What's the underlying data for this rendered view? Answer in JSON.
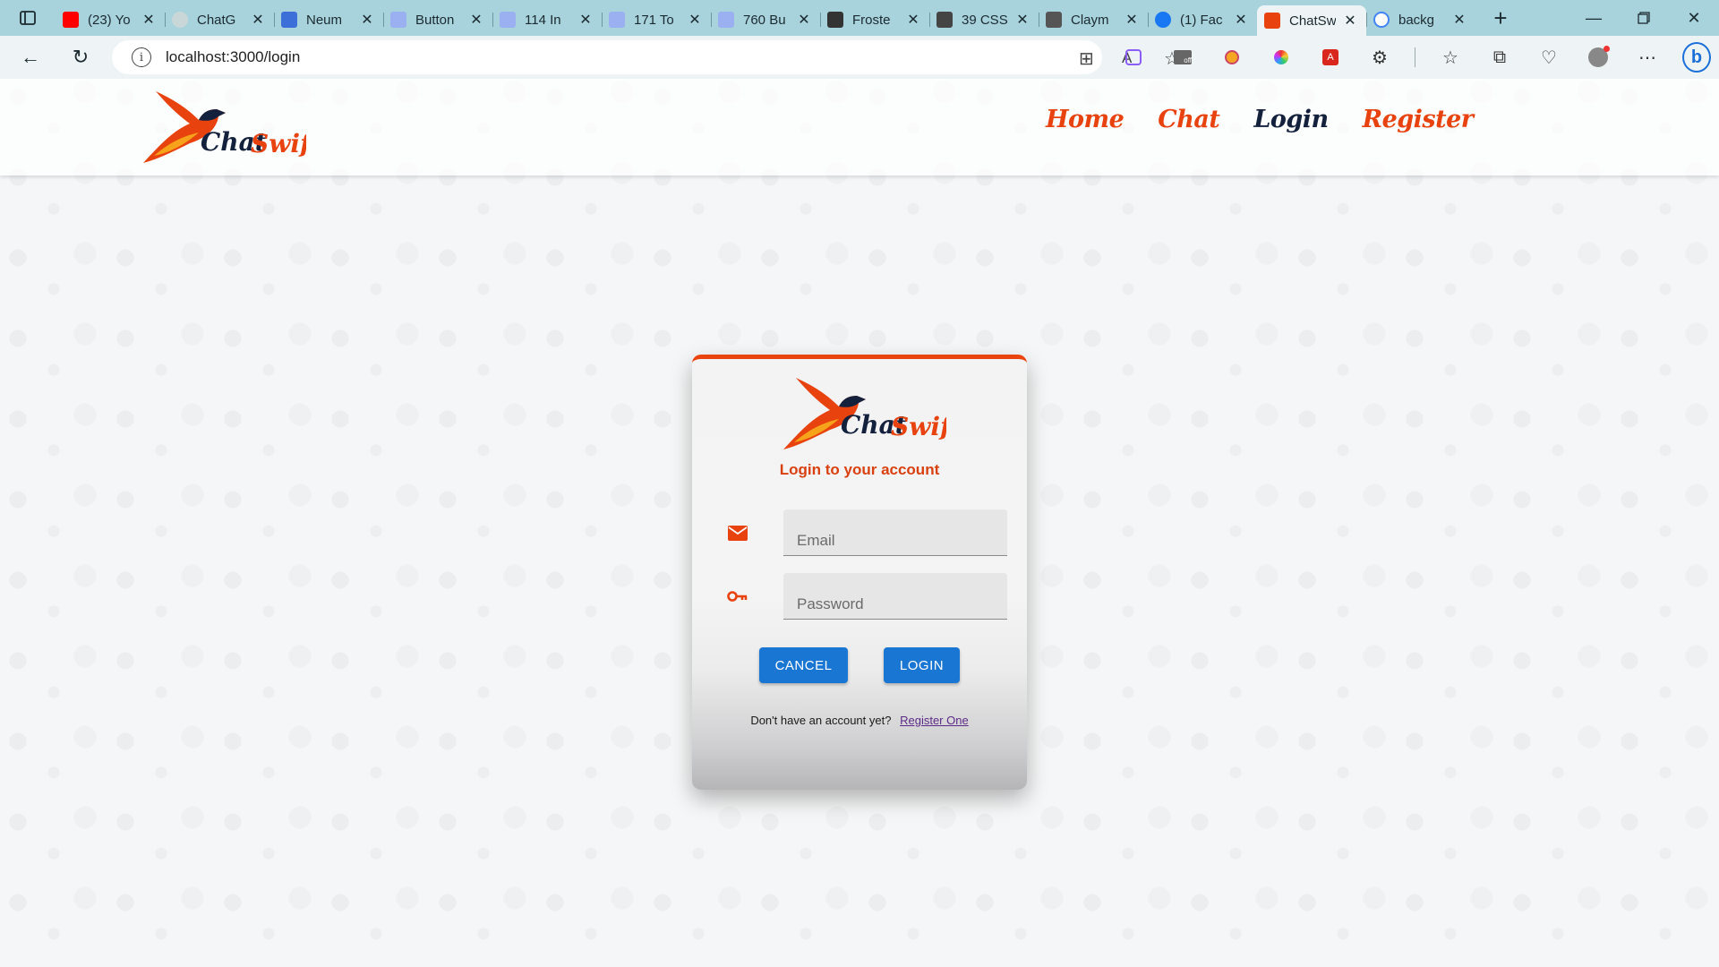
{
  "browser": {
    "tabs": [
      {
        "title": "(23) Yo",
        "favicon": "youtube-icon",
        "color": "#ff0000"
      },
      {
        "title": "ChatG",
        "favicon": "chatgpt-icon",
        "color": "#c9d7d9"
      },
      {
        "title": "Neum",
        "favicon": "neumorphism-icon",
        "color": "#3d6fd8"
      },
      {
        "title": "Button",
        "favicon": "uiverse-icon",
        "color": "#9ab0f0"
      },
      {
        "title": "114 In",
        "favicon": "uiverse-icon",
        "color": "#9ab0f0"
      },
      {
        "title": "171 To",
        "favicon": "uiverse-icon",
        "color": "#9ab0f0"
      },
      {
        "title": "760 Bu",
        "favicon": "uiverse-icon",
        "color": "#9ab0f0"
      },
      {
        "title": "Froste",
        "favicon": "dev-icon",
        "color": "#333333"
      },
      {
        "title": "39 CSS",
        "favicon": "f-icon",
        "color": "#444444"
      },
      {
        "title": "Claym",
        "favicon": "claymorphism-icon",
        "color": "#555555"
      },
      {
        "title": "(1) Fac",
        "favicon": "facebook-icon",
        "color": "#1877f2"
      },
      {
        "title": "ChatSw",
        "favicon": "chatswift-bird-icon",
        "color": "#e8420f",
        "active": true
      },
      {
        "title": "backg",
        "favicon": "google-icon",
        "color": "#ffffff"
      }
    ],
    "url": "localhost:3000/login"
  },
  "site": {
    "brand": "ChatSwift",
    "nav": [
      {
        "label": "Home",
        "current": false
      },
      {
        "label": "Chat",
        "current": false
      },
      {
        "label": "Login",
        "current": true
      },
      {
        "label": "Register",
        "current": false
      }
    ]
  },
  "login": {
    "title": "Login to your account",
    "email_placeholder": "Email",
    "password_placeholder": "Password",
    "cancel_label": "CANCEL",
    "login_label": "LOGIN",
    "no_account_text": "Don't have an account yet?",
    "register_link_label": "Register One"
  },
  "colors": {
    "accent": "#e8420f",
    "nav_current": "#14213d",
    "button": "#1976d2",
    "tabbar": "#a8d3dc"
  }
}
